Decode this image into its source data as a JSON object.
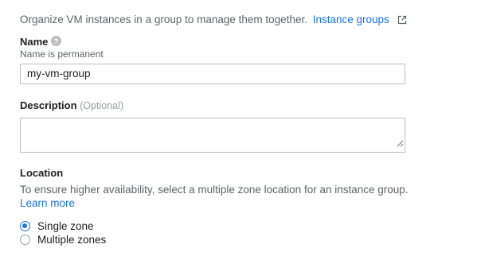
{
  "intro": {
    "text": "Organize VM instances in a group to manage them together.",
    "link": "Instance groups",
    "link_icon": "external-link-icon"
  },
  "name_field": {
    "label": "Name",
    "help_icon": "help-icon",
    "hint": "Name is permanent",
    "value": "my-vm-group"
  },
  "description_field": {
    "label": "Description",
    "optional": "(Optional)",
    "value": ""
  },
  "location": {
    "label": "Location",
    "description": "To ensure higher availability, select a multiple zone location for an instance group.",
    "learn_more": "Learn more",
    "options": [
      {
        "label": "Single zone",
        "selected": true
      },
      {
        "label": "Multiple zones",
        "selected": false
      }
    ]
  },
  "colors": {
    "accent": "#1a73e8",
    "border": "#bdbdbd",
    "muted": "#5f6368"
  }
}
